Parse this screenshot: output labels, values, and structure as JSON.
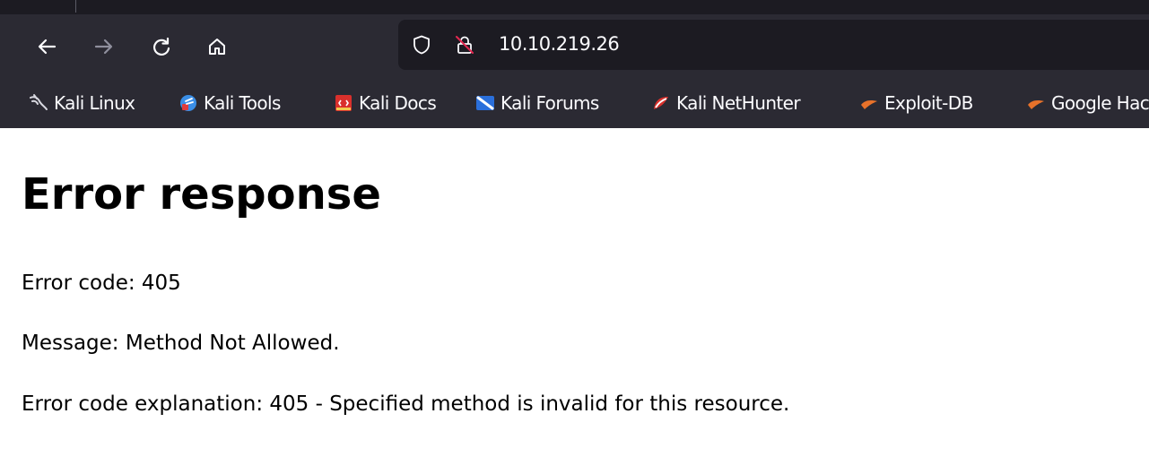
{
  "browser": {
    "address": "10.10.219.26",
    "bookmarks": [
      {
        "label": "Kali Linux",
        "icon": "kali-dragon-icon"
      },
      {
        "label": "Kali Tools",
        "icon": "kali-tools-icon"
      },
      {
        "label": "Kali Docs",
        "icon": "kali-docs-icon"
      },
      {
        "label": "Kali Forums",
        "icon": "kali-forums-icon"
      },
      {
        "label": "Kali NetHunter",
        "icon": "kali-nethunter-icon"
      },
      {
        "label": "Exploit-DB",
        "icon": "exploit-db-icon"
      },
      {
        "label": "Google Hacking DB",
        "icon": "exploit-db-icon"
      }
    ]
  },
  "page": {
    "heading": "Error response",
    "error_code": "Error code: 405",
    "message": "Message: Method Not Allowed.",
    "explanation": "Error code explanation: 405 - Specified method is invalid for this resource."
  },
  "colors": {
    "toolbar": "#2b2a33",
    "urlbar": "#1c1b22",
    "text_light": "#fbfbfe",
    "exploit_orange": "#e8722a"
  }
}
